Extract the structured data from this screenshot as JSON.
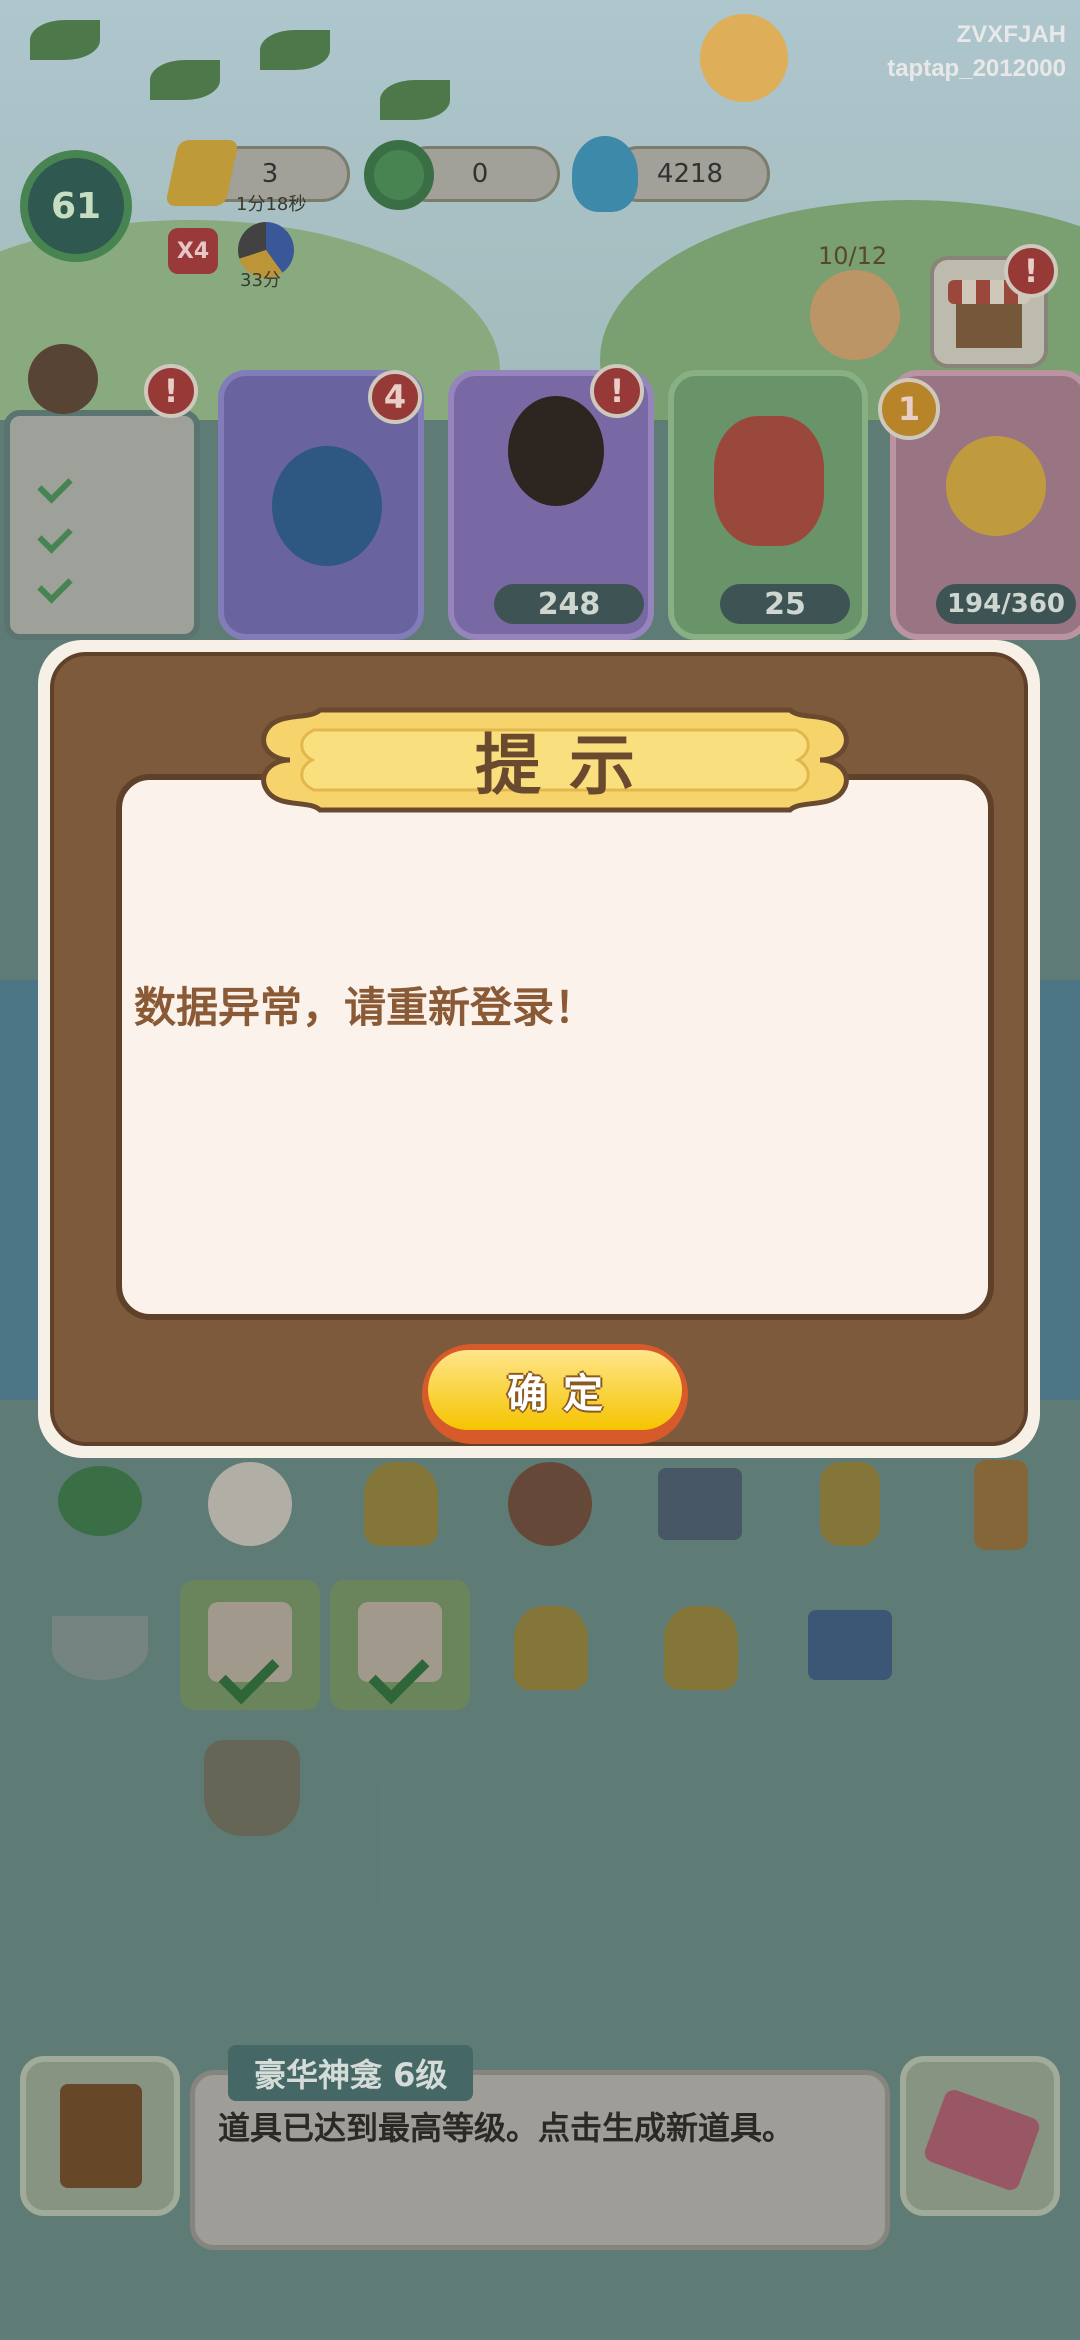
{
  "user": {
    "id_line1": "ZVXFJAH",
    "id_line2": "taptap_2012000"
  },
  "hud": {
    "level": "61",
    "energy": {
      "value": "3",
      "timer": "1分18秒",
      "icon": "lightning-icon"
    },
    "coins": {
      "value": "0",
      "icon": "jade-coin-icon"
    },
    "flame": {
      "value": "4218",
      "icon": "blue-flame-icon"
    },
    "multiplier": "X4",
    "time_badge": "33分",
    "quest_progress": "10/12"
  },
  "cards": [
    {
      "name": "guitar-card",
      "badge": "4"
    },
    {
      "name": "character-card",
      "value": "248"
    },
    {
      "name": "horse-card",
      "value": "25"
    },
    {
      "name": "flower-card",
      "badge": "1",
      "value": "194/360"
    }
  ],
  "bottom": {
    "item_title": "豪华神龛 6级",
    "item_desc": "道具已达到最高等级。点击生成新道具。"
  },
  "dialog": {
    "title": "提示",
    "message": "数据异常，请重新登录！",
    "confirm_label": "确定"
  },
  "colors": {
    "dialog_frame": "#7e5a3c",
    "dialog_body": "#fbf3eb",
    "title_plate": "#f6d36b",
    "button_yellow": "#f5c400",
    "message_text": "#8a5a36"
  }
}
